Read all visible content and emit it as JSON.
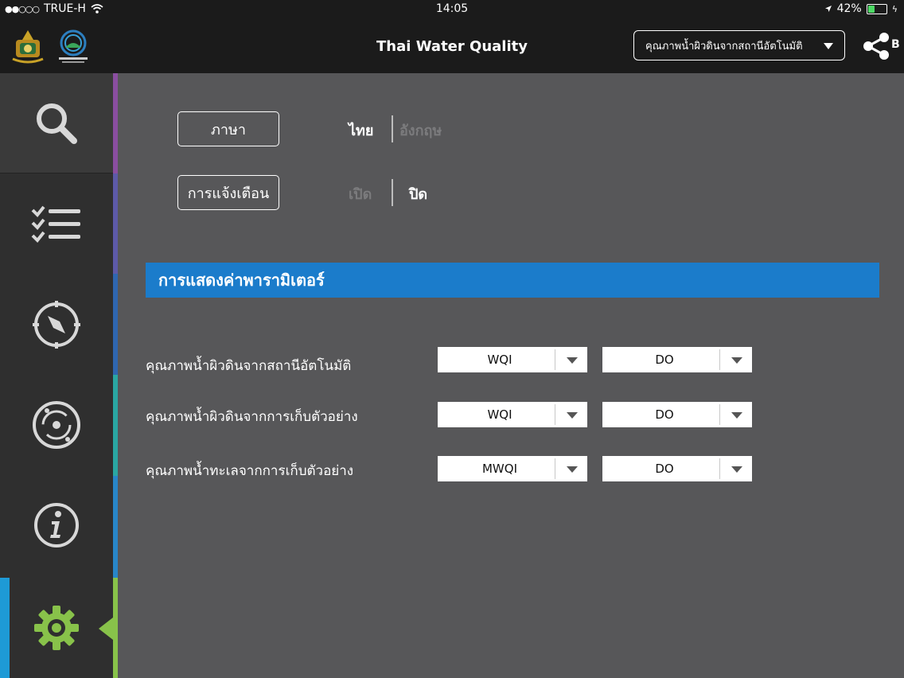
{
  "statusbar": {
    "carrier": "TRUE-H",
    "time": "14:05",
    "battery_text": "42%",
    "battery_level": 0.42
  },
  "header": {
    "title": "Thai Water Quality",
    "station_select": "คุณภาพน้ำผิวดินจากสถานีอัตโนมัติ",
    "share_trailing": "B"
  },
  "sidebar": {
    "items": [
      {
        "name": "search",
        "icon": "search-icon"
      },
      {
        "name": "list",
        "icon": "checklist-icon"
      },
      {
        "name": "compass",
        "icon": "compass-icon"
      },
      {
        "name": "radar",
        "icon": "radar-icon"
      },
      {
        "name": "info",
        "icon": "info-icon"
      },
      {
        "name": "settings",
        "icon": "gear-icon",
        "active": true
      }
    ],
    "stripe_colors": [
      "#8a4ea0",
      "#5d5aa8",
      "#2f66b0",
      "#2aa7a2",
      "#2886c8",
      "#88c24a"
    ],
    "active_color": "#88c24a"
  },
  "settings": {
    "language": {
      "label": "ภาษา",
      "options": [
        "ไทย",
        "อังกฤษ"
      ],
      "selected": "ไทย"
    },
    "notification": {
      "label": "การแจ้งเตือน",
      "options": [
        "เปิด",
        "ปิด"
      ],
      "selected": "ปิด"
    },
    "parameter_section": {
      "title": "การแสดงค่าพารามิเตอร์",
      "rows": [
        {
          "label": "คุณภาพน้ำผิวดินจากสถานีอัตโนมัติ",
          "index": "WQI",
          "param": "DO"
        },
        {
          "label": "คุณภาพน้ำผิวดินจากการเก็บตัวอย่าง",
          "index": "WQI",
          "param": "DO"
        },
        {
          "label": "คุณภาพน้ำทะเลจากการเก็บตัวอย่าง",
          "index": "MWQI",
          "param": "DO"
        }
      ]
    }
  },
  "colors": {
    "section_bar": "#1b7ccb",
    "background": "#575759",
    "bar": "#1b1b1b"
  }
}
